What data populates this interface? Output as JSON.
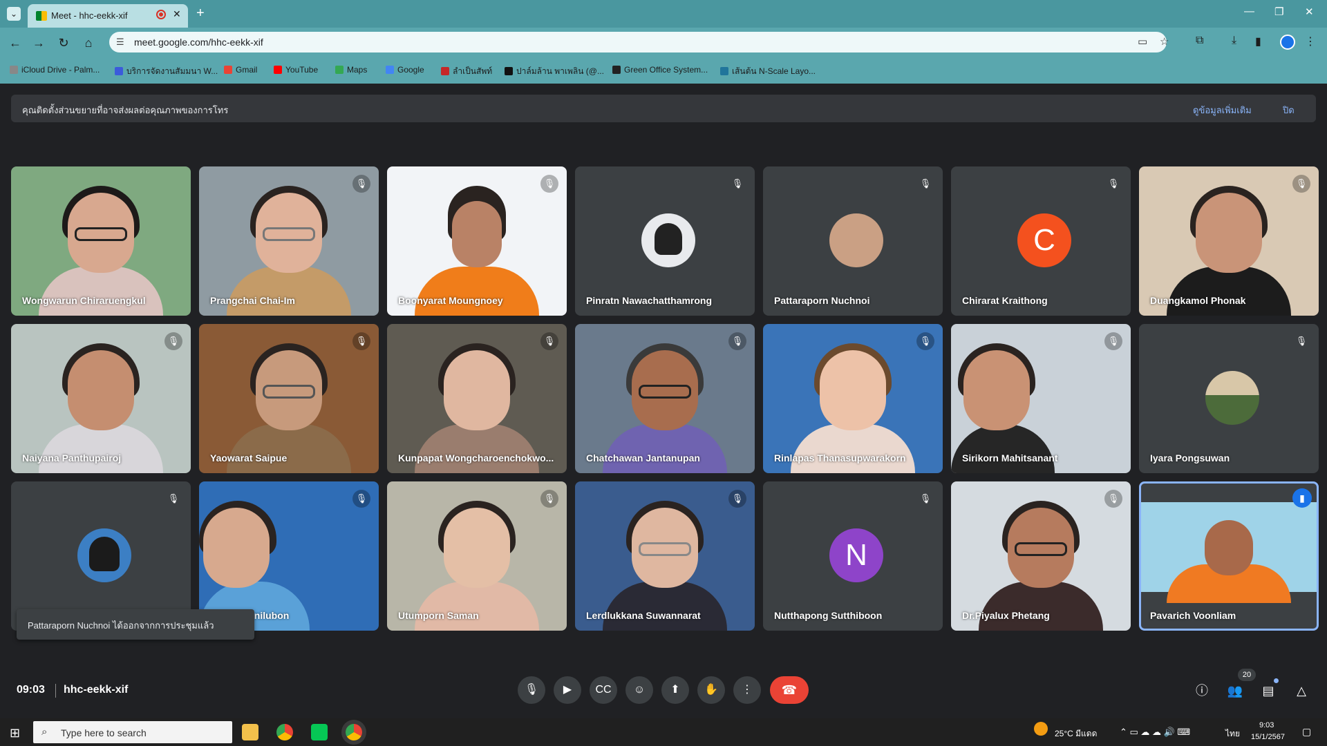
{
  "browser": {
    "tab_title": "Meet - hhc-eekk-xif",
    "url": "meet.google.com/hhc-eekk-xif",
    "bookmarks": [
      {
        "label": "iCloud Drive - Palm..."
      },
      {
        "label": "บริการจัดงานสัมมนา W..."
      },
      {
        "label": "Gmail"
      },
      {
        "label": "YouTube"
      },
      {
        "label": "Maps"
      },
      {
        "label": "Google"
      },
      {
        "label": "ลำเป็นสัพท์"
      },
      {
        "label": "ปาล์มล้าน พาเพลิน (@..."
      },
      {
        "label": "Green Office System..."
      },
      {
        "label": "เส้นต้น N-Scale Layo..."
      }
    ]
  },
  "banner": {
    "message": "คุณติดตั้งส่วนขยายที่อาจส่งผลต่อคุณภาพของการโทร",
    "more_label": "ดูข้อมูลเพิ่มเติม",
    "close_label": "ปิด"
  },
  "participants": [
    {
      "name": "Wongwarun Chiraruengkul"
    },
    {
      "name": "Prangchai Chai-Im"
    },
    {
      "name": "Boonyarat Moungnoey"
    },
    {
      "name": "Pinratn Nawachatthamrong"
    },
    {
      "name": "Pattaraporn Nuchnoi"
    },
    {
      "name": "Chirarat Kraithong",
      "initial": "C"
    },
    {
      "name": "Duangkamol Phonak"
    },
    {
      "name": "Naiyana Panthupairoj"
    },
    {
      "name": "Yaowarat Saipue"
    },
    {
      "name": "Kunpapat Wongcharoenchokwo..."
    },
    {
      "name": "Chatchawan Jantanupan"
    },
    {
      "name": "Rinlapas Thanasupwarakorn"
    },
    {
      "name": "Sirikorn Mahitsanant"
    },
    {
      "name": "Iyara Pongsuwan"
    },
    {
      "name": ""
    },
    {
      "name": "...arapornnilubon"
    },
    {
      "name": "Utumporn Saman"
    },
    {
      "name": "Lerdlukkana Suwannarat"
    },
    {
      "name": "Nutthapong Sutthiboon",
      "initial": "N"
    },
    {
      "name": "Dr.Piyalux Phetang"
    },
    {
      "name": "Pavarich Voonliam"
    }
  ],
  "toast": "Pattaraporn Nuchnoi ได้ออกจากการประชุมแล้ว",
  "meeting": {
    "time": "09:03",
    "code": "hhc-eekk-xif",
    "participant_count": "20"
  },
  "taskbar": {
    "search_placeholder": "Type here to search",
    "weather": "25°C มีแดด",
    "lang": "ไทย",
    "time": "9:03",
    "date": "15/1/2567"
  },
  "colors": {
    "accent": "#8ab4f8",
    "end_call": "#ea4335",
    "chirarat_avatar": "#f4511e",
    "nutthapong_avatar": "#8e44c9"
  }
}
